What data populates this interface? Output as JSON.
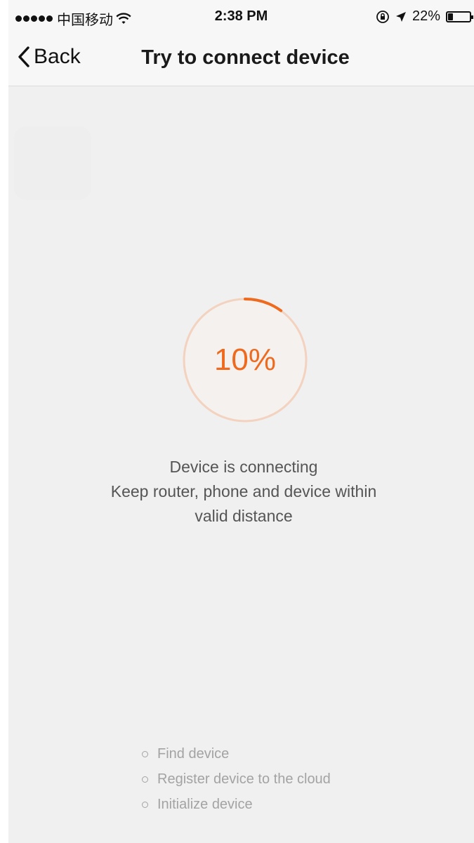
{
  "status_bar": {
    "carrier": "中国移动",
    "time": "2:38 PM",
    "battery_percent": "22%",
    "battery_level": 0.22,
    "icons": [
      "signal-icon",
      "wifi-icon",
      "rotation-lock-icon",
      "location-arrow-icon",
      "battery-icon"
    ]
  },
  "nav": {
    "back_label": "Back",
    "title": "Try to connect device"
  },
  "progress": {
    "value": 0.1,
    "label": "10%",
    "accent_color": "#ee6a1e",
    "track_color": "#f3d2bf"
  },
  "message": {
    "line1": "Device is connecting",
    "line2": "Keep router, phone and device within",
    "line3": "valid distance"
  },
  "steps": [
    {
      "label": "Find device"
    },
    {
      "label": "Register device to the cloud"
    },
    {
      "label": "Initialize device"
    }
  ]
}
